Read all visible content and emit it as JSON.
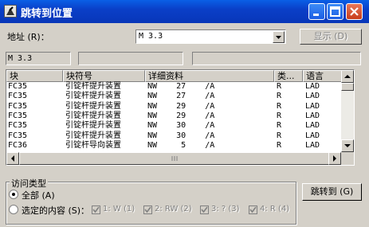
{
  "window": {
    "title": "跳转到位置"
  },
  "address": {
    "label": "地址 (R)：",
    "value": "M          3.3",
    "display_button": "显示 (D)"
  },
  "info_fields": [
    "M          3.3",
    "",
    ""
  ],
  "table": {
    "headers": [
      "块",
      "块符号",
      "详细资料",
      "类...",
      "语言"
    ],
    "rows": [
      {
        "block": "FC35",
        "symbol": "引锭杆提升装置",
        "details": "NW    27    /A",
        "type": "R",
        "lang": "LAD"
      },
      {
        "block": "FC35",
        "symbol": "引锭杆提升装置",
        "details": "NW    27    /A",
        "type": "R",
        "lang": "LAD"
      },
      {
        "block": "FC35",
        "symbol": "引锭杆提升装置",
        "details": "NW    29    /A",
        "type": "R",
        "lang": "LAD"
      },
      {
        "block": "FC35",
        "symbol": "引锭杆提升装置",
        "details": "NW    29    /A",
        "type": "R",
        "lang": "LAD"
      },
      {
        "block": "FC35",
        "symbol": "引锭杆提升装置",
        "details": "NW    30    /A",
        "type": "R",
        "lang": "LAD"
      },
      {
        "block": "FC35",
        "symbol": "引锭杆提升装置",
        "details": "NW    30    /A",
        "type": "R",
        "lang": "LAD"
      },
      {
        "block": "FC36",
        "symbol": "引锭杆导向装置",
        "details": "NW     5    /A",
        "type": "R",
        "lang": "LAD"
      }
    ]
  },
  "access": {
    "group_title": "访问类型",
    "all_label": "全部 (A)",
    "selected_label": "选定的内容 (S)：",
    "checkboxes": [
      "1: W (1)",
      "2: RW (2)",
      "3: ? (3)",
      "4: R (4)"
    ]
  },
  "goto_button": "跳转到 (G)",
  "colors": {
    "title_bar": "#0a3fc8",
    "face": "#d4d0c8"
  }
}
